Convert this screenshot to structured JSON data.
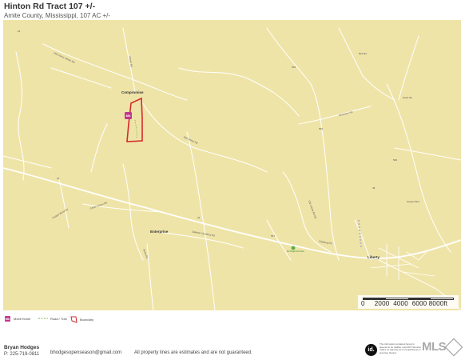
{
  "header": {
    "title": "Hinton Rd Tract 107 +/-",
    "subtitle": "Amite County, Mississippi, 107 AC +/-"
  },
  "map": {
    "background_color": "#efe4a8",
    "boundary_color": "#d42a2a",
    "places": [
      "Compromise",
      "Enterprise",
      "Liberty"
    ],
    "road_labels": [
      "Old Cherry Hinton Rd",
      "Hinton Rd",
      "Old Liberty Rd",
      "Ebenezer Rd",
      "Carter Hinton Rd",
      "Oaktree Cemetery Rd",
      "Pearl Rd",
      "Bird Rd",
      "Copper Bend Rd",
      "Old Liberty Rd NE",
      "Gloster Bird",
      "Gillsburg Rd",
      "Smith Rd"
    ],
    "route_shields": [
      "24",
      "24",
      "24",
      "569",
      "569",
      "567",
      "584",
      "48"
    ],
    "poi": "Mt Pisgah Rd Park",
    "marker_label": "Mh"
  },
  "scale": {
    "labels": [
      "0",
      "2000",
      "4000",
      "6000",
      "8000ft"
    ]
  },
  "legend": {
    "mobile_home": "Mobil Home",
    "road_trail": "Road / Trail",
    "boundary": "Boundary",
    "mh_icon_color": "#c0388d",
    "trail_color": "#8bb34b",
    "boundary_color": "#d42a2a"
  },
  "footer": {
    "agent_name": "Bryan Hodges",
    "phone": "P: 225-719-0811",
    "email": "bhodgesopenseason@gmail.com",
    "disclaimer": "All property lines are estimates and are not guaranteed.",
    "id_badge": "id.",
    "id_disclaimer": "The information contained herein is deemed to be reliable. Land ID® Services makes no warranty as to completeness or accuracy thereof.",
    "mls_logo": "MLS"
  }
}
